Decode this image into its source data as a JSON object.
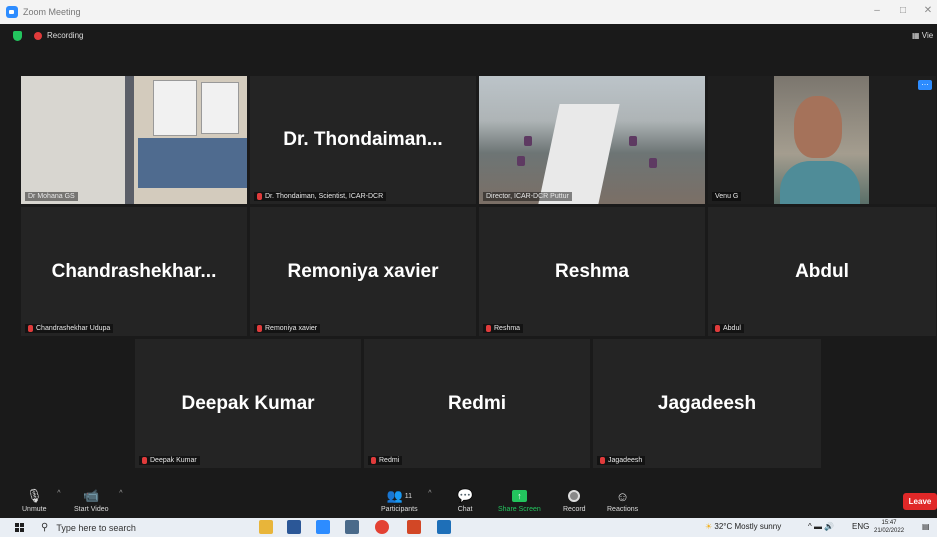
{
  "window": {
    "title": "Zoom Meeting",
    "controls": [
      "–",
      "□",
      "✕"
    ]
  },
  "meeting_bar": {
    "recording_label": "Recording",
    "view_label": "Vie"
  },
  "tiles": [
    {
      "name": "",
      "label": "Dr Mohana GS",
      "video": "whiteboard",
      "muted": false
    },
    {
      "name": "Dr. Thondaiman...",
      "label": "Dr. Thondaiman, Scientist, ICAR-DCR",
      "video": "none",
      "muted": true
    },
    {
      "name": "",
      "label": "Director, ICAR-DCR Puttur",
      "video": "conference-room",
      "muted": false
    },
    {
      "name": "",
      "label": "Venu G",
      "video": "person",
      "muted": false,
      "active_speaker": true
    },
    {
      "name": "Chandrashekhar...",
      "label": "Chandrashekhar Udupa",
      "video": "none",
      "muted": true
    },
    {
      "name": "Remoniya xavier",
      "label": "Remoniya xavier",
      "video": "none",
      "muted": true
    },
    {
      "name": "Reshma",
      "label": "Reshma",
      "video": "none",
      "muted": true
    },
    {
      "name": "Abdul",
      "label": "Abdul",
      "video": "none",
      "muted": true
    },
    {
      "name": "Deepak Kumar",
      "label": "Deepak Kumar",
      "video": "none",
      "muted": true
    },
    {
      "name": "Redmi",
      "label": "Redmi",
      "video": "none",
      "muted": true
    },
    {
      "name": "Jagadeesh",
      "label": "Jagadeesh",
      "video": "none",
      "muted": true
    }
  ],
  "toolbar": {
    "unmute": "Unmute",
    "start_video": "Start Video",
    "participants": "Participants",
    "participant_count": "11",
    "chat": "Chat",
    "share_screen": "Share Screen",
    "record": "Record",
    "reactions": "Reactions",
    "leave": "Leave"
  },
  "taskbar": {
    "search_placeholder": "Type here to search",
    "weather": "32°C  Mostly sunny",
    "language": "ENG",
    "time": "15:47",
    "date": "21/02/2022"
  },
  "colors": {
    "share_green": "#23c45e",
    "leave_red": "#e02828",
    "active_outline": "#c9e86b",
    "zoom_blue": "#2d8cff"
  }
}
